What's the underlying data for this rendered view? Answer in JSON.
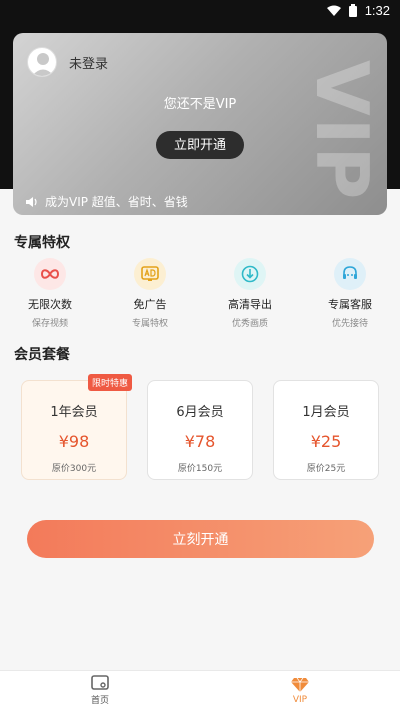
{
  "status": {
    "time": "1:32"
  },
  "vip_card": {
    "login_text": "未登录",
    "status_text": "您还不是VIP",
    "open_label": "立即开通",
    "watermark": "VIP",
    "promo_text": "成为VIP 超值、省时、省钱"
  },
  "privileges": {
    "title": "专属特权",
    "items": [
      {
        "title": "无限次数",
        "subtitle": "保存视频",
        "icon": "infinity-icon",
        "color": "#e9504a"
      },
      {
        "title": "免广告",
        "subtitle": "专属特权",
        "icon": "ad-icon",
        "color": "#e3a21a"
      },
      {
        "title": "高清导出",
        "subtitle": "优秀画质",
        "icon": "download-icon",
        "color": "#2fb9c8"
      },
      {
        "title": "专属客服",
        "subtitle": "优先接待",
        "icon": "headset-icon",
        "color": "#2fa6d8"
      }
    ]
  },
  "plans": {
    "title": "会员套餐",
    "badge": "限时特惠",
    "items": [
      {
        "name": "1年会员",
        "price": "¥98",
        "original": "原价300元"
      },
      {
        "name": "6月会员",
        "price": "¥78",
        "original": "原价150元"
      },
      {
        "name": "1月会员",
        "price": "¥25",
        "original": "原价25元"
      }
    ]
  },
  "cta": {
    "label": "立刻开通"
  },
  "nav": {
    "home_label": "首页",
    "vip_label": "VIP",
    "active_color": "#f08b3a"
  }
}
